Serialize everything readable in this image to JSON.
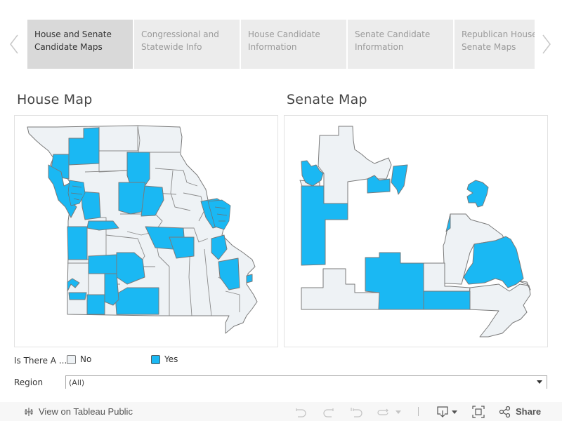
{
  "tabs": {
    "prev_icon": "chevron-left-icon",
    "next_icon": "chevron-right-icon",
    "items": [
      {
        "line1": "House and Senate",
        "line2": "Candidate Maps",
        "active": true
      },
      {
        "line1": "Congressional and",
        "line2": "Statewide Info",
        "active": false
      },
      {
        "line1": "House Candidate",
        "line2": "Information",
        "active": false
      },
      {
        "line1": "Senate Candidate",
        "line2": "Information",
        "active": false
      },
      {
        "line1": "Republican House",
        "line2": "Senate Maps",
        "active": false
      }
    ]
  },
  "house_map": {
    "title": "House Map"
  },
  "senate_map": {
    "title": "Senate Map"
  },
  "colors": {
    "yes": "#1ab8f3",
    "no": "#eef2f5",
    "border": "#777777"
  },
  "legend": {
    "label": "Is There A ...",
    "items": [
      {
        "label": "No",
        "color": "#eef2f5"
      },
      {
        "label": "Yes",
        "color": "#1ab8f3"
      }
    ]
  },
  "filter": {
    "label": "Region",
    "value": "(All)"
  },
  "toolbar": {
    "view_on_label": "View on Tableau Public",
    "share_label": "Share",
    "icons": [
      "tableau-logo-icon",
      "undo-icon",
      "redo-icon",
      "revert-icon",
      "refresh-icon",
      "download-icon",
      "fullscreen-icon",
      "share-icon"
    ]
  }
}
